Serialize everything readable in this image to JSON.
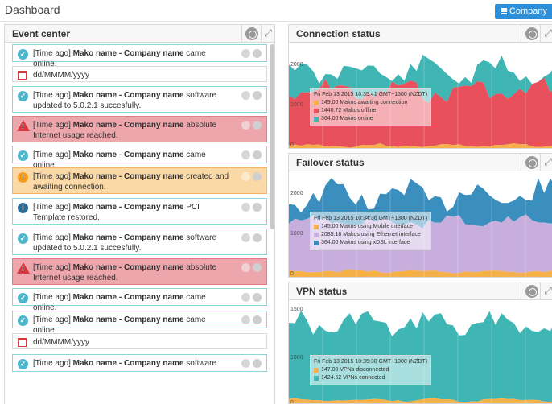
{
  "header": {
    "title": "Dashboard",
    "company_button": "Company"
  },
  "event_center": {
    "title": "Event center",
    "events": [
      {
        "kind": "ok",
        "time": "[Time ago]",
        "mako": "Mako name",
        "sep": "-",
        "company": "Company name",
        "text": "came online."
      },
      {
        "kind": "date",
        "text": "dd/MMMM/yyyy"
      },
      {
        "kind": "ok",
        "time": "[Time ago]",
        "mako": "Mako name",
        "sep": "-",
        "company": "Company name",
        "text": "software updated to 5.0.2.1 succesfully."
      },
      {
        "kind": "alert",
        "time": "[Time ago]",
        "mako": "Mako name",
        "sep": "-",
        "company": "Company name",
        "text": "absolute Internet usage reached."
      },
      {
        "kind": "ok",
        "time": "[Time ago]",
        "mako": "Mako name",
        "sep": "-",
        "company": "Company name",
        "text": "came online."
      },
      {
        "kind": "warn",
        "time": "[Time ago]",
        "mako": "Mako name",
        "sep": "-",
        "company": "Company name",
        "text": "created and awaiting connection."
      },
      {
        "kind": "info",
        "time": "[Time ago]",
        "mako": "Mako name",
        "sep": "-",
        "company": "Company name",
        "text": "PCI Template restored."
      },
      {
        "kind": "ok",
        "time": "[Time ago]",
        "mako": "Mako name",
        "sep": "-",
        "company": "Company name",
        "text": "software updated to 5.0.2.1 succesfully."
      },
      {
        "kind": "alert",
        "time": "[Time ago]",
        "mako": "Mako name",
        "sep": "-",
        "company": "Company name",
        "text": "absolute Internet usage reached."
      },
      {
        "kind": "ok",
        "time": "[Time ago]",
        "mako": "Mako name",
        "sep": "-",
        "company": "Company name",
        "text": "came online."
      },
      {
        "kind": "ok",
        "time": "[Time ago]",
        "mako": "Mako name",
        "sep": "-",
        "company": "Company name",
        "text": "came online."
      },
      {
        "kind": "date",
        "text": "dd/MMMM/yyyy"
      },
      {
        "kind": "ok",
        "time": "[Time ago]",
        "mako": "Mako name",
        "sep": "-",
        "company": "Company name",
        "text": "software"
      }
    ]
  },
  "connection": {
    "title": "Connection status",
    "y_labels": [
      "2000",
      "1000",
      "0"
    ],
    "tooltip": {
      "date": "Fri Feb 13 2015 10:35:41 GMT+1300 (NZDT)",
      "rows": [
        {
          "text": "149.00 Makos awaiting connection",
          "color": "#f5b04a"
        },
        {
          "text": "1440.72 Makos offline",
          "color": "#e8505b"
        },
        {
          "text": "364.00 Makos online",
          "color": "#3fb5b4"
        }
      ]
    }
  },
  "failover": {
    "title": "Failover status",
    "y_labels": [
      "2000",
      "1000",
      "0"
    ],
    "tooltip": {
      "date": "Fri Feb 13 2015 10:34:36 GMT+1300 (NZDT)",
      "rows": [
        {
          "text": "145.00 Makos using Mobile interface",
          "color": "#f5b04a"
        },
        {
          "text": "2085.18 Makos using Ethernet interface",
          "color": "#c7aedd"
        },
        {
          "text": "364.00 Makos using xDSL interface",
          "color": "#3a8fbf"
        }
      ]
    }
  },
  "vpn": {
    "title": "VPN status",
    "y_labels": [
      "1500",
      "1000",
      "0"
    ],
    "tooltip": {
      "date": "Fri Feb 13 2015 10:35:30 GMT+1300 (NZDT)",
      "rows": [
        {
          "text": "147.00 VPNs disconnected",
          "color": "#f5b04a"
        },
        {
          "text": "1424.52 VPNs connected",
          "color": "#3fb5b4"
        }
      ]
    }
  },
  "colors": {
    "accent": "#2d8fd7",
    "red": "#e8505b",
    "teal": "#3fb5b4",
    "orange": "#f5b04a",
    "purple": "#c7aedd",
    "blue": "#3a8fbf"
  }
}
